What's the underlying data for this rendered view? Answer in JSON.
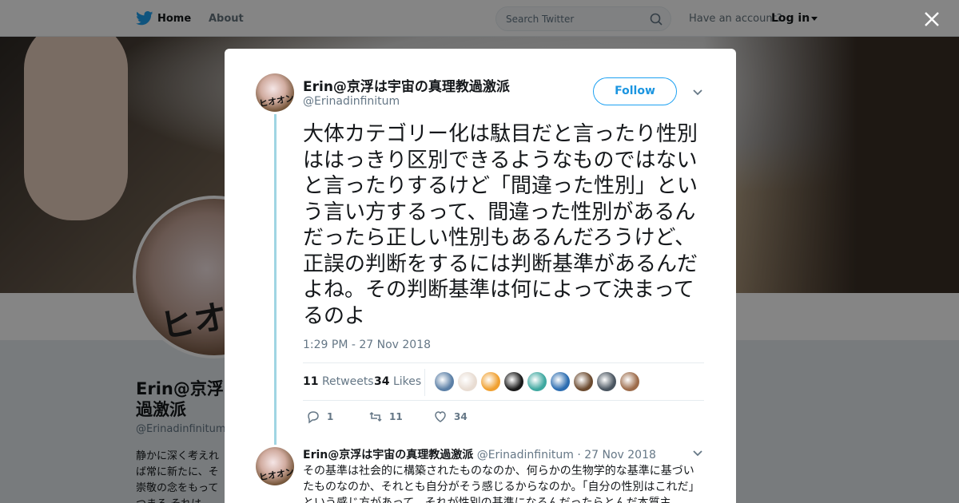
{
  "topbar": {
    "home_label": "Home",
    "about_label": "About",
    "search_placeholder": "Search Twitter",
    "have_account": "Have an account?",
    "login_label": "Log in"
  },
  "profile": {
    "name_line1": "Erin@京浮は",
    "name_line2": "過激派",
    "handle": "@Erinadinfinitum",
    "bio": "静かに深く考えれば常に新たに、そ崇敬の念をもってつまる それは"
  },
  "tweet": {
    "author_name": "Erin@京浮は宇宙の真理教過激派",
    "author_handle": "@Erinadinfinitum",
    "follow_label": "Follow",
    "text": "大体カテゴリー化は駄目だと言ったり性別ははっきり区別できるようなものではないと言ったりするけど「間違った性別」という言い方するって、間違った性別があるんだったら正しい性別もあるんだろうけど、正誤の判断をするには判断基準があるんだよね。その判断基準は何によって決まってるのよ",
    "timestamp": "1:29 PM - 27 Nov 2018",
    "retweets_count": "11",
    "retweets_label": "Retweets",
    "likes_count": "34",
    "likes_label": "Likes",
    "replies_action_count": "1",
    "retweets_action_count": "11",
    "likes_action_count": "34",
    "liker_avatar_colors": [
      "#5b7fa6",
      "#e8dcd2",
      "#f0a030",
      "#1a1a1a",
      "#3fa8a0",
      "#2b6cb0",
      "#6b4a2f",
      "#4a5560",
      "#9c6b4a"
    ]
  },
  "reply": {
    "author_name": "Erin@京浮は宇宙の真理教過激派",
    "author_handle": "@Erinadinfinitum",
    "date": "27 Nov 2018",
    "text": "その基準は社会的に構築されたものなのか、何らかの生物学的な基準に基づいたものなのか、それとも自分がそう感じるからなのか。「自分の性別はこれだ」という感じ方があって、それが性別の基準になるんだったらとんだ本質主"
  },
  "colors": {
    "accent": "#1da1f2",
    "thread_line": "#a0d5e3",
    "text_secondary": "#657786"
  }
}
